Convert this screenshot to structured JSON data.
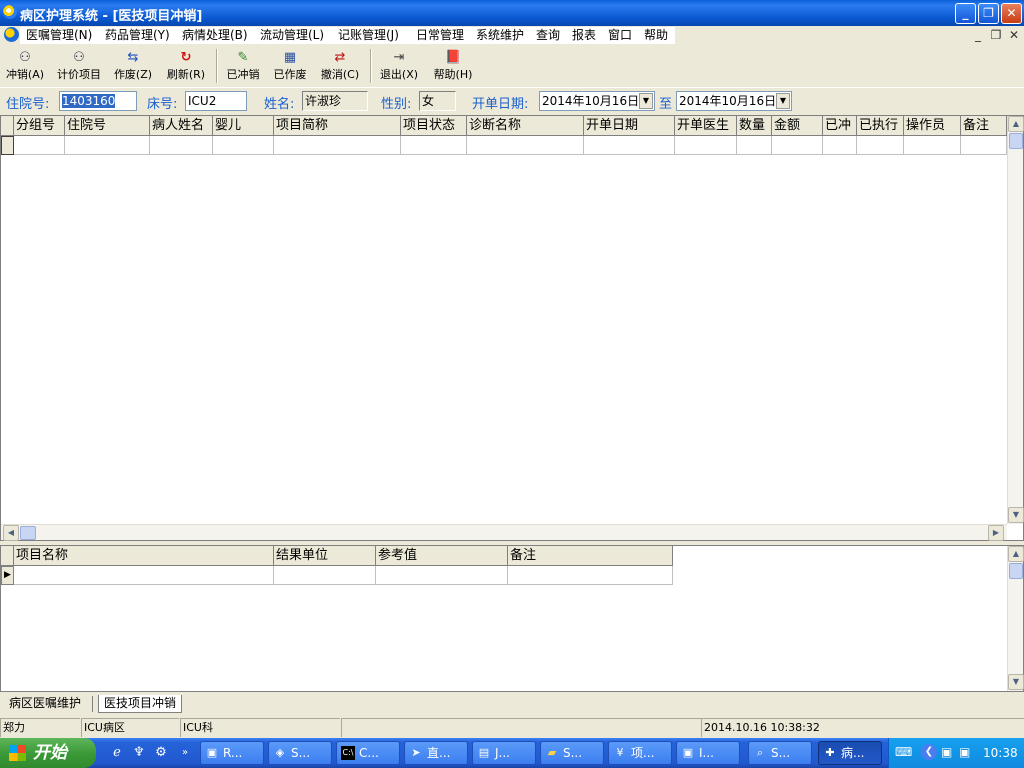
{
  "window": {
    "title": "病区护理系统 - [医技项目冲销]"
  },
  "menus": [
    "医嘱管理(N)",
    "药品管理(Y)",
    "病情处理(B)",
    "流动管理(L)",
    "记账管理(J)",
    "日常管理",
    "系统维护",
    "查询",
    "报表",
    "窗口",
    "帮助"
  ],
  "toolbar": [
    {
      "label": "冲销(A)",
      "icon": "reverse-icon"
    },
    {
      "label": "计价项目",
      "icon": "pricing-icon"
    },
    {
      "label": "作废(Z)",
      "icon": "void-icon"
    },
    {
      "label": "刷新(R)",
      "icon": "refresh-icon"
    },
    {
      "label": "已冲销",
      "icon": "reversed-icon"
    },
    {
      "label": "已作废",
      "icon": "voided-icon"
    },
    {
      "label": "撤消(C)",
      "icon": "undo-icon"
    },
    {
      "label": "退出(X)",
      "icon": "exit-icon"
    },
    {
      "label": "帮助(H)",
      "icon": "help-book-icon"
    }
  ],
  "filter": {
    "admission_label": "住院号:",
    "admission_value": "1403160",
    "bed_label": "床号:",
    "bed_value": "ICU2",
    "name_label": "姓名:",
    "name_value": "许淑珍",
    "sex_label": "性别:",
    "sex_value": "女",
    "date_label": "开单日期:",
    "date_from": "2014年10月16日",
    "date_to_label": "至",
    "date_to": "2014年10月16日"
  },
  "main_grid": {
    "columns": [
      "分组号",
      "住院号",
      "病人姓名",
      "婴儿",
      "项目简称",
      "项目状态",
      "诊断名称",
      "开单日期",
      "开单医生",
      "数量",
      "金额",
      "已冲",
      "已执行",
      "操作员",
      "备注"
    ]
  },
  "detail_grid": {
    "columns": [
      "项目名称",
      "结果单位",
      "参考值",
      "备注"
    ]
  },
  "tabs": [
    "病区医嘱维护",
    "医技项目冲销"
  ],
  "status": {
    "user": "郑力",
    "ward": "ICU病区",
    "dept": "ICU科",
    "empty": "",
    "datetime": "2014.10.16 10:38:32"
  },
  "taskbar": {
    "start_label": "开始",
    "tasks": [
      {
        "label": "R...",
        "icon": "app-icon"
      },
      {
        "label": "S...",
        "icon": "settings-icon"
      },
      {
        "label": "C...",
        "icon": "cmd-icon"
      },
      {
        "label": "直...",
        "icon": "shortcut-icon"
      },
      {
        "label": "J...",
        "icon": "document-icon"
      },
      {
        "label": "S...",
        "icon": "folder-icon"
      },
      {
        "label": "项...",
        "icon": "yen-icon"
      },
      {
        "label": "I...",
        "icon": "app-icon"
      },
      {
        "label": "S...",
        "icon": "query-icon"
      },
      {
        "label": "病...",
        "icon": "hospital-icon"
      }
    ],
    "clock": "10:38"
  }
}
